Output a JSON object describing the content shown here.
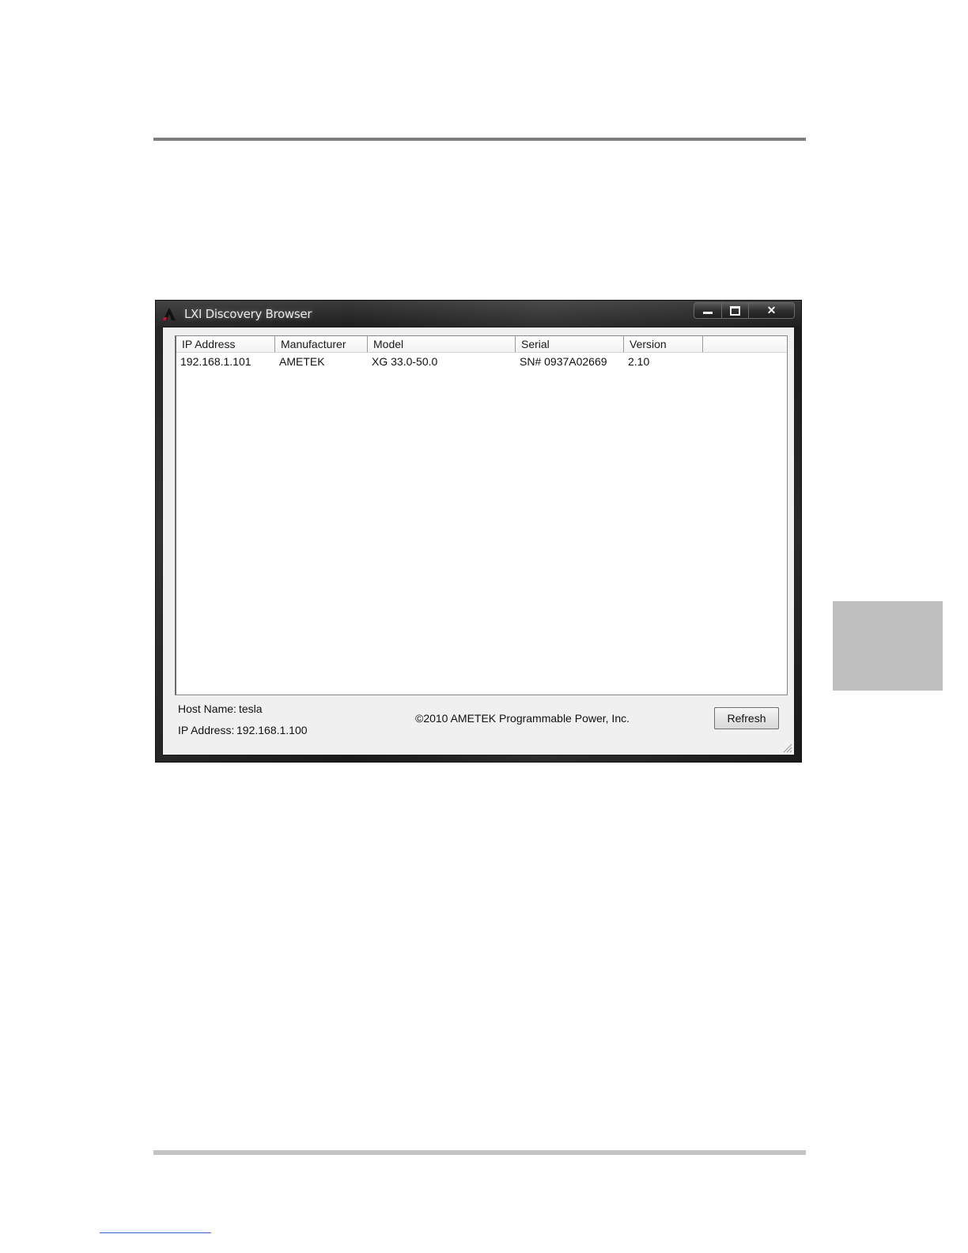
{
  "window": {
    "title": "LXI Discovery Browser",
    "caption_buttons": {
      "minimize_icon": "minimize-icon",
      "maximize_icon": "maximize-icon",
      "close_glyph": "✕"
    }
  },
  "table": {
    "columns": [
      "IP Address",
      "Manufacturer",
      "Model",
      "Serial",
      "Version"
    ],
    "rows": [
      [
        "192.168.1.101",
        "AMETEK",
        "XG 33.0-50.0",
        "SN# 0937A02669",
        "2.10"
      ]
    ]
  },
  "status": {
    "host_name_label": "Host Name:",
    "host_name_value": "tesla",
    "ip_address_label": "IP Address:",
    "ip_address_value": "192.168.1.100",
    "copyright": "©2010 AMETEK Programmable Power, Inc."
  },
  "buttons": {
    "refresh_label": "Refresh"
  },
  "colors": {
    "frame": "#1c1c1c",
    "client_bg": "#f0f0f0",
    "side_tab": "#bfbfbf",
    "rule_top": "#7d7d7d",
    "rule_bottom": "#c4c4c4"
  }
}
